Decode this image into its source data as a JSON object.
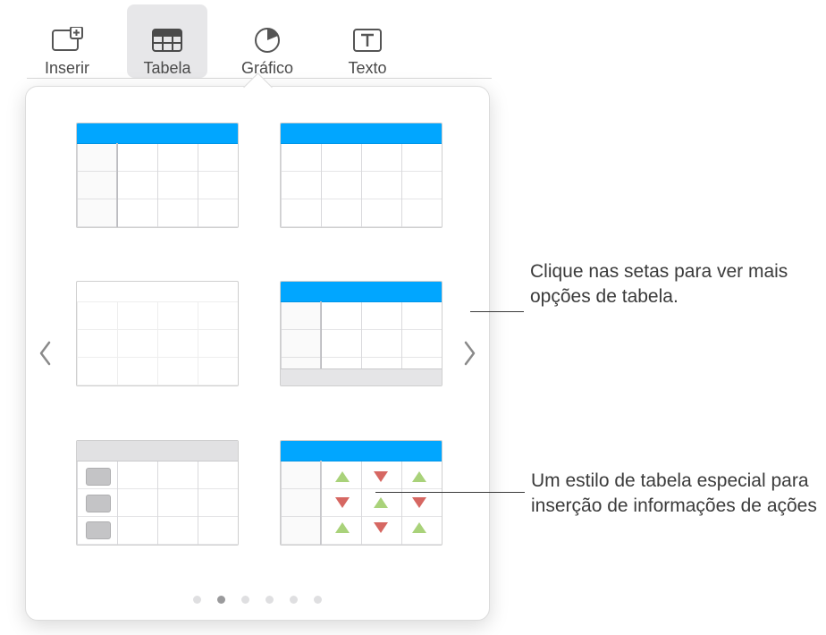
{
  "toolbar": {
    "insert_label": "Inserir",
    "table_label": "Tabela",
    "chart_label": "Gráfico",
    "text_label": "Texto"
  },
  "popover": {
    "page_count": 6,
    "active_page": 2
  },
  "callouts": {
    "arrows": "Clique nas setas para ver mais opções de tabela.",
    "stock": "Um estilo de tabela especial para inserção de informações de ações"
  },
  "table_styles": [
    {
      "name": "header-row-left-column",
      "accent": "#01a6ff",
      "header": true,
      "left_column": true,
      "footer": false,
      "marker": "none"
    },
    {
      "name": "header-row-only",
      "accent": "#01a6ff",
      "header": true,
      "left_column": false,
      "footer": false,
      "marker": "none"
    },
    {
      "name": "plain-no-header",
      "accent": "none",
      "header": false,
      "left_column": false,
      "footer": false,
      "marker": "none"
    },
    {
      "name": "header-row-footer",
      "accent": "#01a6ff",
      "header": true,
      "left_column": true,
      "footer": true,
      "marker": "none"
    },
    {
      "name": "checkbox-rows",
      "accent": "#e1e1e3",
      "header": true,
      "left_column": true,
      "footer": false,
      "marker": "checkbox"
    },
    {
      "name": "stock-arrows",
      "accent": "#01a6ff",
      "header": true,
      "left_column": true,
      "footer": false,
      "marker": "stock-arrows",
      "arrow_pattern": [
        "up",
        "down",
        "up",
        "down",
        "up",
        "down",
        "up",
        "down",
        "up"
      ]
    }
  ]
}
